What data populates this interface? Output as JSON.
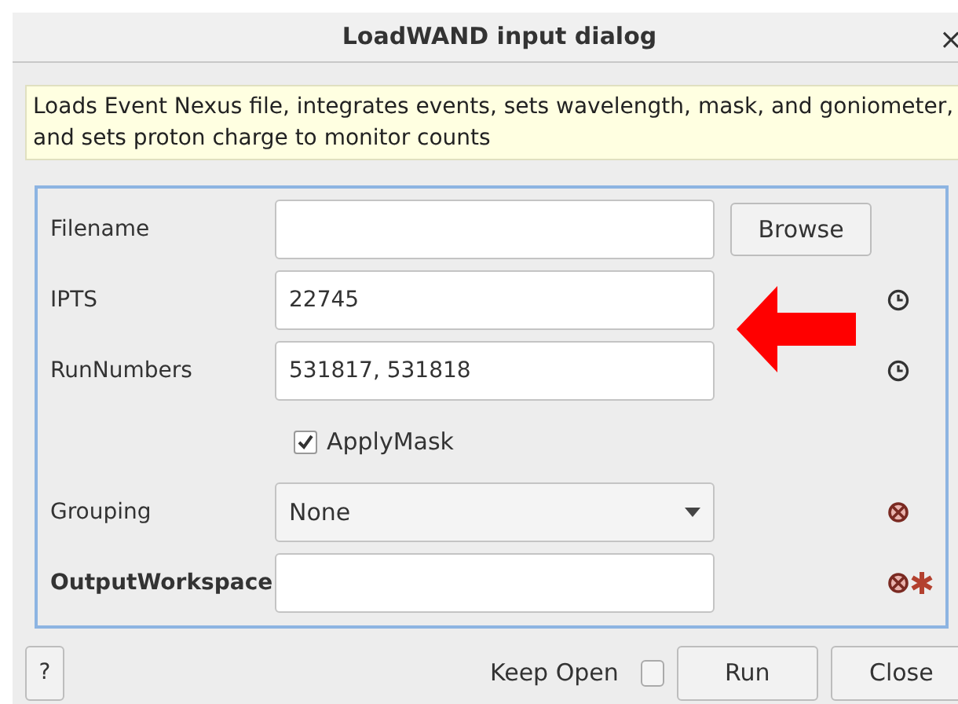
{
  "window": {
    "title": "LoadWAND input dialog",
    "close": "×"
  },
  "description": "Loads Event Nexus file, integrates events, sets wavelength, mask, and goniometer,\nand sets proton charge to monitor counts",
  "properties": [
    {
      "kind": "file",
      "label": "Filename",
      "button": "Browse"
    },
    {
      "kind": "text",
      "label": "IPTS",
      "value": "22745",
      "remembered": true,
      "invalid": false,
      "required": false
    },
    {
      "kind": "text",
      "label": "RunNumbers",
      "value": "531817, 531818",
      "remembered": true,
      "invalid": false,
      "required": false
    },
    {
      "kind": "checkbox",
      "label": "ApplyMask",
      "checked": true
    },
    {
      "kind": "dropdown",
      "label": "Grouping",
      "value": "None",
      "remembered": false,
      "invalid": true,
      "required": false
    },
    {
      "kind": "text",
      "label": "OutputWorkspace",
      "remembered": false,
      "invalid": true,
      "required": true
    }
  ],
  "footer": {
    "help": "?",
    "keep_open": {
      "label": "Keep Open",
      "checked": false
    },
    "buttons": [
      "Run",
      "Close"
    ]
  }
}
